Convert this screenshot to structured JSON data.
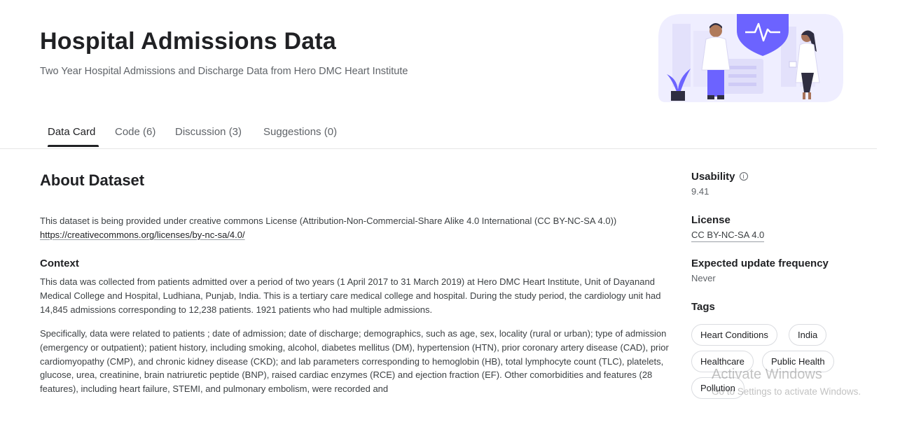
{
  "header": {
    "title": "Hospital Admissions Data",
    "subtitle": "Two Year Hospital Admissions and Discharge Data from Hero DMC Heart Institute"
  },
  "tabs": [
    {
      "label": "Data Card",
      "active": true
    },
    {
      "label": "Code (6)",
      "active": false
    },
    {
      "label": "Discussion (3)",
      "active": false
    },
    {
      "label": "Suggestions (0)",
      "active": false
    }
  ],
  "about": {
    "heading": "About Dataset",
    "license_text": "This dataset is being provided under creative commons License (Attribution-Non-Commercial-Share Alike 4.0 International (CC BY-NC-SA 4.0))",
    "license_link": "https://creativecommons.org/licenses/by-nc-sa/4.0/",
    "context_heading": "Context",
    "context_text": "This data was collected from patients admitted over a period of two years (1 April 2017 to 31 March 2019) at Hero DMC Heart Institute, Unit of Dayanand Medical College and Hospital, Ludhiana, Punjab, India. This is a tertiary care medical college and hospital. During the study period, the cardiology unit had 14,845 admissions corresponding to 12,238 patients. 1921 patients who had multiple admissions.",
    "specifics_text": "Specifically, data were related to patients ; date of admission; date of discharge; demographics, such as age, sex, locality (rural or urban); type of admission (emergency or outpatient); patient history, including smoking, alcohol, diabetes mellitus (DM), hypertension (HTN), prior coronary artery disease (CAD), prior cardiomyopathy (CMP), and chronic kidney disease (CKD); and lab parameters corresponding to hemoglobin (HB), total lymphocyte count (TLC), platelets, glucose, urea, creatinine, brain natriuretic peptide (BNP), raised cardiac enzymes (RCE) and ejection fraction (EF). Other comorbidities and features (28 features), including heart failure, STEMI, and pulmonary embolism, were recorded and"
  },
  "sidebar": {
    "usability_label": "Usability",
    "usability_value": "9.41",
    "license_label": "License",
    "license_value": "CC BY-NC-SA 4.0",
    "frequency_label": "Expected update frequency",
    "frequency_value": "Never",
    "tags_label": "Tags",
    "tags": [
      "Heart Conditions",
      "India",
      "Healthcare",
      "Public Health",
      "Pollution"
    ]
  },
  "watermark": {
    "line1": "Activate Windows",
    "line2": "Go to Settings to activate Windows."
  },
  "colors": {
    "illustration_purple": "#6c63ff",
    "illustration_light": "#ecebff"
  }
}
